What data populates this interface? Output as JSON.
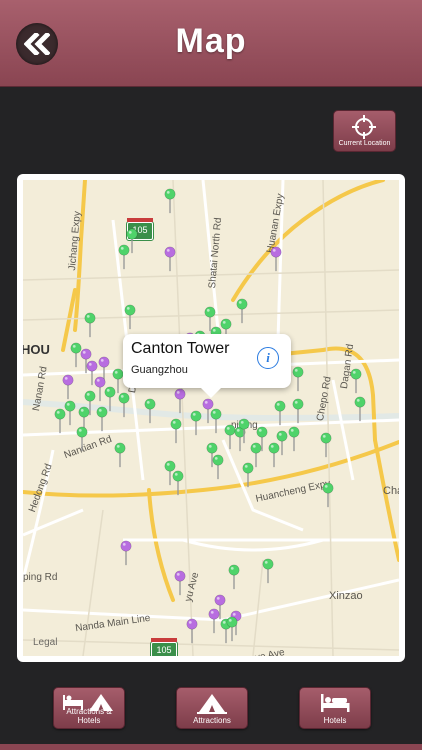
{
  "header": {
    "title": "Map"
  },
  "current_location": {
    "label": "Current Location"
  },
  "map": {
    "callout": {
      "title": "Canton Tower",
      "subtitle": "Guangzhou"
    },
    "labels": {
      "jichang_expy": "Jichang Expy",
      "shatai_north_rd": "Shatai North Rd",
      "huanan_expy": "Huanan Expy",
      "hou": "HOU",
      "nanan_rd": "Nanan Rd",
      "dongfeng": "Dongfe",
      "nantian_rd": "Nantian Rd",
      "hedong_rd": "Hedong Rd",
      "huancheng_expy": "Huancheng Expy",
      "chepo_rd": "Chepo Rd",
      "dagan_rd": "Dagan Rd",
      "cha": "Cha",
      "zhujiang": "njiang",
      "ping_rd": "ping Rd",
      "xinzao": "Xinzao",
      "nanda_main_line": "Nanda Main Line",
      "yu_ave": "yu Ave",
      "ave": "ve Ave"
    },
    "shield_105_top": "105",
    "shield_105_bottom": "105",
    "legal": "Legal"
  },
  "tabs": [
    {
      "label": "Attractions & Hotels"
    },
    {
      "label": "Attractions"
    },
    {
      "label": "Hotels"
    }
  ],
  "colors": {
    "accent": "#8a4552",
    "pin_green": "#4fd36a",
    "pin_purple": "#b86de0"
  }
}
